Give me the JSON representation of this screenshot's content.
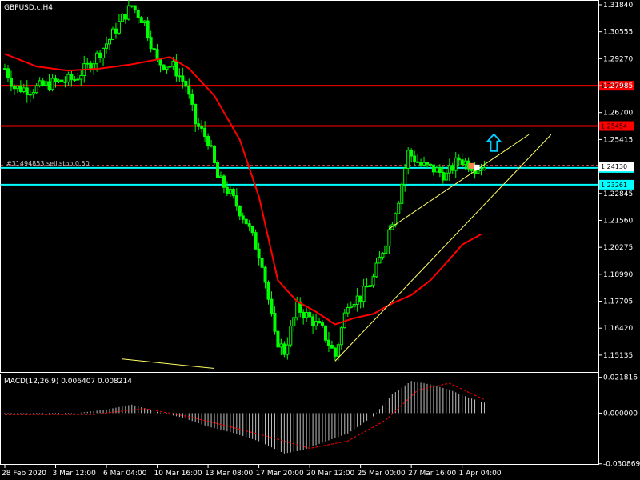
{
  "window": {
    "title": "GBPUSD,c,H4"
  },
  "colors": {
    "background": "#000000",
    "grid": "#ffffff",
    "bull": "#00ff00",
    "bear": "#00ff00",
    "ma": "#ff0000",
    "hline_red": "#ff0000",
    "hline_cyan": "#00ffff",
    "trend": "#ffff66",
    "arrow": "#00ccff",
    "macd_hist": "#c0c0c0",
    "macd_signal": "#ff0000"
  },
  "chart_data": [
    {
      "type": "candlestick",
      "title": "GBPUSD,c,H4",
      "y_ticks": [
        "1.31840",
        "1.30555",
        "1.29270",
        "1.27985",
        "1.26700",
        "1.25415",
        "1.24130",
        "1.22845",
        "1.21560",
        "1.20275",
        "1.18990",
        "1.17705",
        "1.16420",
        "1.15135"
      ],
      "y_tick_values": [
        1.3184,
        1.30555,
        1.2927,
        1.27985,
        1.267,
        1.25415,
        1.2413,
        1.22845,
        1.2156,
        1.20275,
        1.1899,
        1.17705,
        1.1642,
        1.15135
      ],
      "ylim": [
        1.1433,
        1.3203
      ],
      "x_ticks": [
        "28 Feb 2020",
        "3 Mar 12:00",
        "6 Mar 04:00",
        "10 Mar 16:00",
        "13 Mar 08:00",
        "17 Mar 20:00",
        "20 Mar 12:00",
        "25 Mar 00:00",
        "27 Mar 16:00",
        "1 Apr 04:00"
      ],
      "x_tick_index": [
        0,
        16,
        32,
        48,
        64,
        80,
        96,
        112,
        128,
        144
      ],
      "bar_count": 152,
      "close_path": [
        {
          "i": 0,
          "v": 1.288
        },
        {
          "i": 3,
          "v": 1.279
        },
        {
          "i": 8,
          "v": 1.278
        },
        {
          "i": 15,
          "v": 1.281
        },
        {
          "i": 22,
          "v": 1.283
        },
        {
          "i": 28,
          "v": 1.292
        },
        {
          "i": 33,
          "v": 1.302
        },
        {
          "i": 37,
          "v": 1.312
        },
        {
          "i": 40,
          "v": 1.318
        },
        {
          "i": 44,
          "v": 1.31
        },
        {
          "i": 48,
          "v": 1.291
        },
        {
          "i": 53,
          "v": 1.289
        },
        {
          "i": 57,
          "v": 1.28
        },
        {
          "i": 60,
          "v": 1.262
        },
        {
          "i": 64,
          "v": 1.254
        },
        {
          "i": 67,
          "v": 1.236
        },
        {
          "i": 71,
          "v": 1.228
        },
        {
          "i": 76,
          "v": 1.215
        },
        {
          "i": 81,
          "v": 1.196
        },
        {
          "i": 85,
          "v": 1.16
        },
        {
          "i": 88,
          "v": 1.153
        },
        {
          "i": 92,
          "v": 1.174
        },
        {
          "i": 96,
          "v": 1.169
        },
        {
          "i": 100,
          "v": 1.163
        },
        {
          "i": 104,
          "v": 1.151
        },
        {
          "i": 108,
          "v": 1.177
        },
        {
          "i": 112,
          "v": 1.179
        },
        {
          "i": 116,
          "v": 1.188
        },
        {
          "i": 120,
          "v": 1.206
        },
        {
          "i": 124,
          "v": 1.226
        },
        {
          "i": 127,
          "v": 1.248
        },
        {
          "i": 131,
          "v": 1.242
        },
        {
          "i": 135,
          "v": 1.24
        },
        {
          "i": 139,
          "v": 1.237
        },
        {
          "i": 143,
          "v": 1.245
        },
        {
          "i": 148,
          "v": 1.241
        },
        {
          "i": 151,
          "v": 1.2413
        }
      ],
      "ma": [
        {
          "i": 0,
          "v": 1.295
        },
        {
          "i": 10,
          "v": 1.289
        },
        {
          "i": 20,
          "v": 1.287
        },
        {
          "i": 30,
          "v": 1.288
        },
        {
          "i": 40,
          "v": 1.29
        },
        {
          "i": 52,
          "v": 1.2935
        },
        {
          "i": 58,
          "v": 1.288
        },
        {
          "i": 66,
          "v": 1.275
        },
        {
          "i": 74,
          "v": 1.254
        },
        {
          "i": 80,
          "v": 1.227
        },
        {
          "i": 86,
          "v": 1.187
        },
        {
          "i": 92,
          "v": 1.177
        },
        {
          "i": 98,
          "v": 1.172
        },
        {
          "i": 104,
          "v": 1.166
        },
        {
          "i": 110,
          "v": 1.169
        },
        {
          "i": 116,
          "v": 1.171
        },
        {
          "i": 122,
          "v": 1.176
        },
        {
          "i": 128,
          "v": 1.18
        },
        {
          "i": 134,
          "v": 1.187
        },
        {
          "i": 140,
          "v": 1.197
        },
        {
          "i": 144,
          "v": 1.204
        },
        {
          "i": 150,
          "v": 1.209
        }
      ],
      "hlines": [
        {
          "label": "1.27985",
          "value": 1.2798,
          "color": "red"
        },
        {
          "label": "1.25454",
          "value": 1.2606,
          "color": "red"
        },
        {
          "label": "1.24061",
          "value": 1.2406,
          "color": "cyan"
        },
        {
          "label": "1.23261",
          "value": 1.2326,
          "color": "cyan"
        }
      ],
      "dashed_level": {
        "value": 1.2418,
        "label": "#31494853 sell stop 0.50"
      },
      "trendlines": [
        {
          "from": {
            "i": 121,
            "v": 1.2116
          },
          "to": {
            "i": 165,
            "v": 1.2565
          }
        },
        {
          "from": {
            "i": 104,
            "v": 1.1485
          },
          "to": {
            "i": 172,
            "v": 1.2565
          }
        },
        {
          "from": {
            "i": 37,
            "v": 1.1495
          },
          "to": {
            "i": 66,
            "v": 1.145
          }
        }
      ],
      "up_arrow": {
        "i": 154,
        "v": 1.2525
      },
      "current_price_label": "1.24130"
    },
    {
      "type": "histogram",
      "title": "MACD(12,26,9) 0.006407 0.008214",
      "y_ticks": [
        "0.021816",
        "0.000000",
        "-0.030869"
      ],
      "y_tick_values": [
        0.021816,
        0.0,
        -0.030869
      ],
      "ylim": [
        -0.031,
        0.0236
      ],
      "histogram": [
        {
          "i": 0,
          "v": -0.0007
        },
        {
          "i": 20,
          "v": -0.0006
        },
        {
          "i": 32,
          "v": 0.0022
        },
        {
          "i": 40,
          "v": 0.0052
        },
        {
          "i": 48,
          "v": 0.0008
        },
        {
          "i": 56,
          "v": -0.0028
        },
        {
          "i": 64,
          "v": -0.0082
        },
        {
          "i": 72,
          "v": -0.0121
        },
        {
          "i": 80,
          "v": -0.0171
        },
        {
          "i": 88,
          "v": -0.0246
        },
        {
          "i": 94,
          "v": -0.0225
        },
        {
          "i": 100,
          "v": -0.018
        },
        {
          "i": 108,
          "v": -0.0124
        },
        {
          "i": 116,
          "v": -0.002
        },
        {
          "i": 122,
          "v": 0.0115
        },
        {
          "i": 128,
          "v": 0.0196
        },
        {
          "i": 134,
          "v": 0.0175
        },
        {
          "i": 140,
          "v": 0.0143
        },
        {
          "i": 146,
          "v": 0.0095
        },
        {
          "i": 151,
          "v": 0.0064
        }
      ],
      "signal": [
        {
          "i": 0,
          "v": -0.001
        },
        {
          "i": 28,
          "v": -0.0008
        },
        {
          "i": 44,
          "v": 0.0028
        },
        {
          "i": 58,
          "v": -0.0022
        },
        {
          "i": 70,
          "v": -0.0078
        },
        {
          "i": 84,
          "v": -0.0148
        },
        {
          "i": 96,
          "v": -0.0215
        },
        {
          "i": 108,
          "v": -0.017
        },
        {
          "i": 120,
          "v": -0.0042
        },
        {
          "i": 130,
          "v": 0.014
        },
        {
          "i": 140,
          "v": 0.0182
        },
        {
          "i": 151,
          "v": 0.0082
        }
      ]
    }
  ]
}
